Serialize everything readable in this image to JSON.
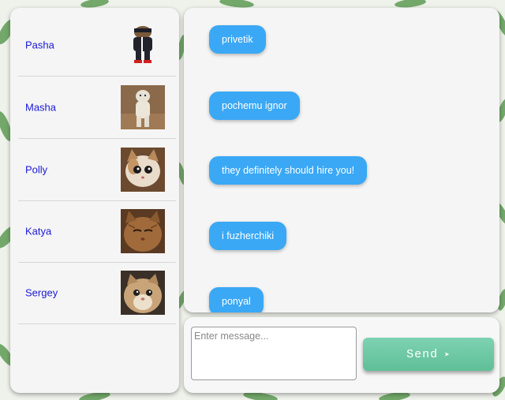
{
  "contacts": [
    {
      "name": "Pasha",
      "avatar": "cat-in-tracksuit"
    },
    {
      "name": "Masha",
      "avatar": "standing-cat"
    },
    {
      "name": "Polly",
      "avatar": "surprised-cat"
    },
    {
      "name": "Katya",
      "avatar": "grumpy-cat"
    },
    {
      "name": "Sergey",
      "avatar": "fluffy-cat"
    }
  ],
  "messages": [
    {
      "text": "privetik"
    },
    {
      "text": "pochemu ignor"
    },
    {
      "text": "they definitely should hire you!"
    },
    {
      "text": "i fuzherchiki"
    },
    {
      "text": "ponyal"
    }
  ],
  "composer": {
    "placeholder": "Enter message...",
    "send_label": "Send",
    "send_icon": "➤"
  },
  "colors": {
    "bubble": "#3aa8f5",
    "contact_name": "#1a1ad6",
    "send_button": "#6cc7a3",
    "background_leaves": "#3f8a3a"
  }
}
